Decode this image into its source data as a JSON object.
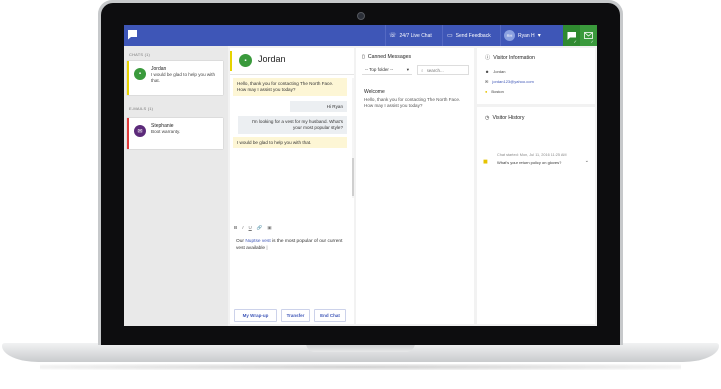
{
  "topbar": {
    "live_chat": "24/7 Live Chat",
    "send_feedback": "Send Feedback",
    "user_initials": "RH",
    "user_name": "Ryan H"
  },
  "left": {
    "chats_title": "CHATS (1)",
    "emails_title": "E-MAILS (1)",
    "chat": {
      "name": "Jordan",
      "message": "I would be glad to help you with that."
    },
    "email": {
      "name": "Stephanie",
      "message": "Boot warranty."
    }
  },
  "conversation": {
    "title": "Jordan",
    "messages": [
      {
        "from": "agent",
        "text": "Hello, thank you for contacting The North Face. How may I assist you today?"
      },
      {
        "from": "visitor",
        "text": "Hi Ryan"
      },
      {
        "from": "visitor",
        "text": "I'm looking for a vest for my husband. What's your most popular style?"
      },
      {
        "from": "agent",
        "text": "I would be glad to help you with that."
      }
    ],
    "toolbar": [
      "B",
      "I",
      "U",
      "🔗",
      "▣"
    ],
    "compose_before": "Our ",
    "compose_link": "Nuptse vest",
    "compose_after": " is the most popular of our current vest available",
    "buttons": {
      "wrap_up": "My Wrap-up",
      "transfer": "Transfer",
      "end_chat": "End Chat"
    }
  },
  "canned": {
    "title": "Canned Messages",
    "folder": "-- Top folder --",
    "search_placeholder": "search...",
    "item_title": "Welcome",
    "item_body": "Hello, thank you for contacting The North Face. How may I assist you today?"
  },
  "visitor": {
    "title": "Visitor Information",
    "name": "Jordan",
    "email": "jordan123@yahoo.com",
    "location": "Boston",
    "history_title": "Visitor History",
    "history_time": "Chat started: Mon, Jul 11, 2016 11:25 AM",
    "history_question": "What's your return policy on gloves?"
  },
  "colors": {
    "brand_blue": "#3e56b7",
    "online_green": "#3a9a3c",
    "chat_accent": "#e6d300",
    "email_accent": "#e03a3a",
    "email_avatar": "#5c2a7a"
  }
}
